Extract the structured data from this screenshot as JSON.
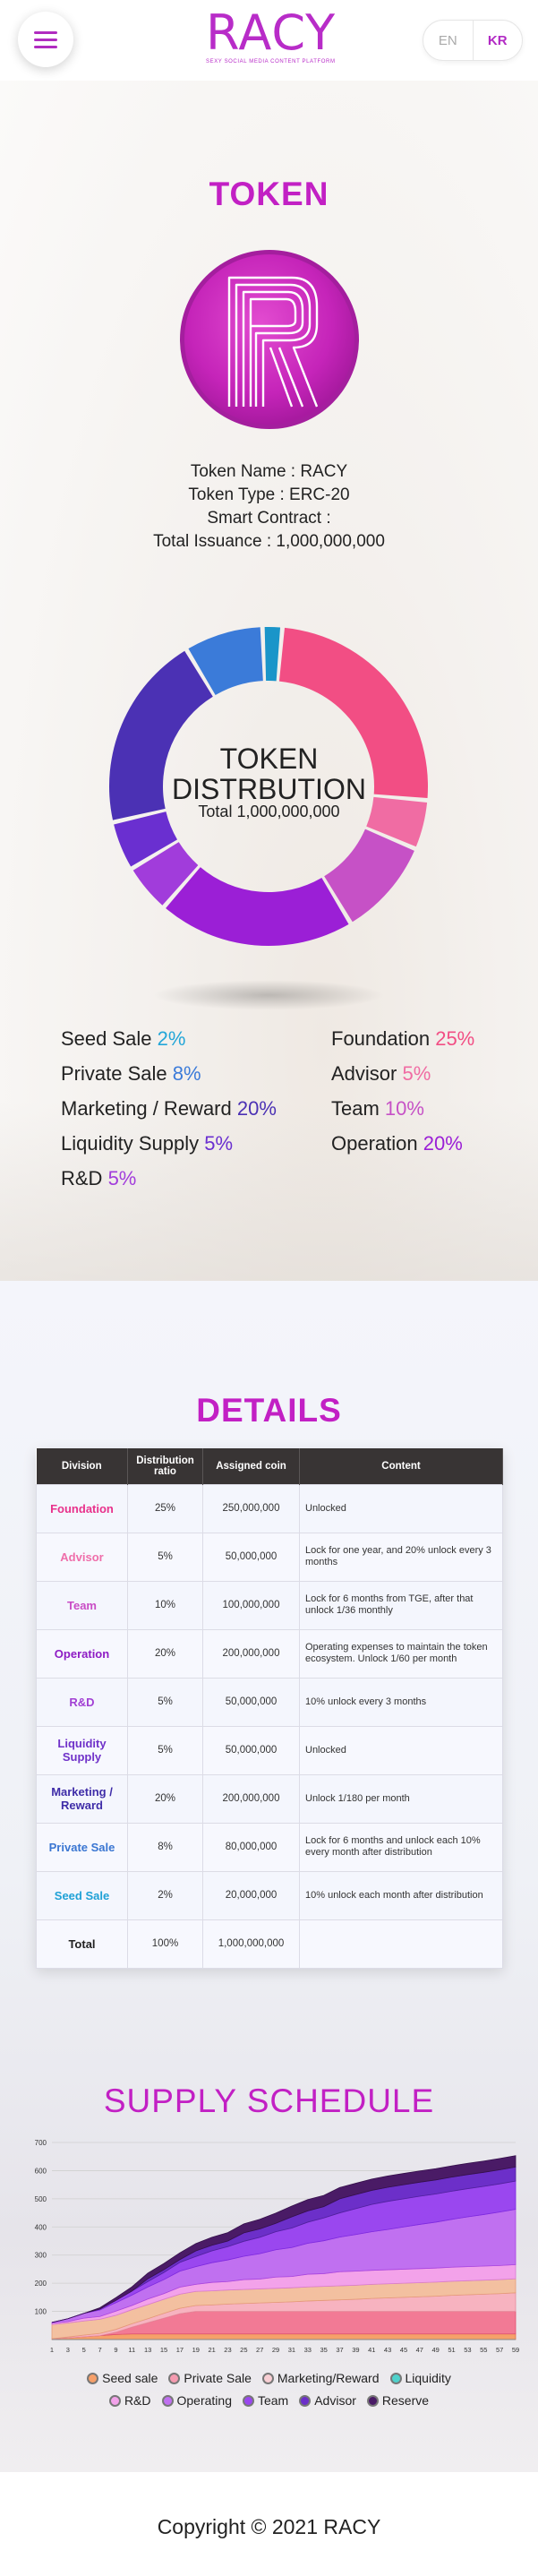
{
  "header": {
    "logo_text": "RACY",
    "logo_tagline": "SEXY SOCIAL MEDIA CONTENT PLATFORM",
    "lang_en": "EN",
    "lang_kr": "KR",
    "menu_icon": "hamburger-icon"
  },
  "token": {
    "title": "TOKEN",
    "icon": "racy-r-token-icon",
    "info_lines": [
      "Token Name : RACY",
      "Token Type : ERC-20",
      "Smart Contract :",
      "Total Issuance : 1,000,000,000"
    ],
    "donut_title_1": "TOKEN",
    "donut_title_2": "DISTRBUTION",
    "donut_total": "Total 1,000,000,000",
    "distribution": [
      {
        "name": "Foundation",
        "pct": 25,
        "pct_label": "25%",
        "color": "#f24e84"
      },
      {
        "name": "Advisor",
        "pct": 5,
        "pct_label": "5%",
        "color": "#f06ca3"
      },
      {
        "name": "Team",
        "pct": 10,
        "pct_label": "10%",
        "color": "#c651c6"
      },
      {
        "name": "Operation",
        "pct": 20,
        "pct_label": "20%",
        "color": "#9b1fd6"
      },
      {
        "name": "R&D",
        "pct": 5,
        "pct_label": "5%",
        "color": "#a13cdb"
      },
      {
        "name": "Liquidity Supply",
        "pct": 5,
        "pct_label": "5%",
        "color": "#6a2fd0"
      },
      {
        "name": "Marketing / Reward",
        "pct": 20,
        "pct_label": "20%",
        "color": "#4b31b4"
      },
      {
        "name": "Private Sale",
        "pct": 8,
        "pct_label": "8%",
        "color": "#3b7bd9"
      },
      {
        "name": "Seed Sale",
        "pct": 2,
        "pct_label": "2%",
        "color": "#1a95c9"
      }
    ],
    "legend_left": [
      {
        "name": "Seed Sale",
        "pct_label": "2%",
        "color": "#23a6d8"
      },
      {
        "name": "Private Sale",
        "pct_label": "8%",
        "color": "#3b7bd9"
      },
      {
        "name": "Marketing / Reward",
        "pct_label": "20%",
        "color": "#4b31b4"
      },
      {
        "name": "Liquidity Supply",
        "pct_label": "5%",
        "color": "#6a2fd0"
      },
      {
        "name": "R&D",
        "pct_label": "5%",
        "color": "#a13cdb"
      }
    ],
    "legend_right": [
      {
        "name": "Foundation",
        "pct_label": "25%",
        "color": "#f24e84"
      },
      {
        "name": "Advisor",
        "pct_label": "5%",
        "color": "#f06ca3"
      },
      {
        "name": "Team",
        "pct_label": "10%",
        "color": "#c651c6"
      },
      {
        "name": "Operation",
        "pct_label": "20%",
        "color": "#9b1fd6"
      }
    ]
  },
  "details": {
    "title": "DETAILS",
    "headers": [
      "Division",
      "Distribution ratio",
      "Assigned coin",
      "Content"
    ],
    "rows": [
      {
        "division": "Foundation",
        "color": "#e8318b",
        "ratio": "25%",
        "coin": "250,000,000",
        "content": "Unlocked"
      },
      {
        "division": "Advisor",
        "color": "#ef6eaa",
        "ratio": "5%",
        "coin": "50,000,000",
        "content": "Lock for one year, and 20% unlock every 3 months"
      },
      {
        "division": "Team",
        "color": "#c94dc5",
        "ratio": "10%",
        "coin": "100,000,000",
        "content": "Lock for 6 months from TGE, after that unlock 1/36 monthly"
      },
      {
        "division": "Operation",
        "color": "#8e1cc4",
        "ratio": "20%",
        "coin": "200,000,000",
        "content": "Operating expenses to maintain the token ecosystem. Unlock 1/60 per month"
      },
      {
        "division": "R&D",
        "color": "#a241d4",
        "ratio": "5%",
        "coin": "50,000,000",
        "content": "10% unlock every 3 months"
      },
      {
        "division": "Liquidity Supply",
        "color": "#7032c9",
        "ratio": "5%",
        "coin": "50,000,000",
        "content": "Unlocked"
      },
      {
        "division": "Marketing / Reward",
        "color": "#3f2da8",
        "ratio": "20%",
        "coin": "200,000,000",
        "content": "Unlock 1/180 per month"
      },
      {
        "division": "Private Sale",
        "color": "#3a76d2",
        "ratio": "8%",
        "coin": "80,000,000",
        "content": "Lock for 6 months and unlock each 10% every month after distribution"
      },
      {
        "division": "Seed Sale",
        "color": "#1fa1d6",
        "ratio": "2%",
        "coin": "20,000,000",
        "content": "10% unlock each month after distribution"
      },
      {
        "division": "Total",
        "color": "#222222",
        "ratio": "100%",
        "coin": "1,000,000,000",
        "content": ""
      }
    ]
  },
  "supply": {
    "title": "SUPPLY SCHEDULE",
    "legend_row1": [
      {
        "name": "Seed sale",
        "color": "#f6a06a"
      },
      {
        "name": "Private Sale",
        "color": "#f59bb0"
      },
      {
        "name": "Marketing/Reward",
        "color": "#f9cfd4"
      },
      {
        "name": "Liquidity",
        "color": "#4fd2cc"
      }
    ],
    "legend_row2": [
      {
        "name": "R&D",
        "color": "#f3a2ea"
      },
      {
        "name": "Operating",
        "color": "#c070f0"
      },
      {
        "name": "Team",
        "color": "#9a47ef"
      },
      {
        "name": "Advisor",
        "color": "#6c2fc9"
      },
      {
        "name": "Reserve",
        "color": "#4a1b66"
      }
    ]
  },
  "chart_data": {
    "type": "area",
    "title": "SUPPLY SCHEDULE",
    "xlabel": "",
    "ylabel": "",
    "ylim": [
      0,
      700
    ],
    "yticks": [
      100,
      200,
      300,
      400,
      500,
      600,
      700
    ],
    "xticks": [
      1,
      3,
      5,
      7,
      9,
      11,
      13,
      15,
      17,
      19,
      21,
      23,
      25,
      27,
      29,
      31,
      33,
      35,
      37,
      39,
      41,
      43,
      45,
      47,
      49,
      51,
      53,
      55,
      57,
      59
    ],
    "x": [
      1,
      3,
      5,
      7,
      9,
      11,
      13,
      15,
      17,
      19,
      21,
      23,
      25,
      27,
      29,
      31,
      33,
      35,
      37,
      39,
      41,
      43,
      45,
      47,
      49,
      51,
      53,
      55,
      57,
      59
    ],
    "stacked": true,
    "series": [
      {
        "name": "Seed sale",
        "values": [
          2,
          6,
          10,
          14,
          18,
          20,
          20,
          20,
          20,
          20,
          20,
          20,
          20,
          20,
          20,
          20,
          20,
          20,
          20,
          20,
          20,
          20,
          20,
          20,
          20,
          20,
          20,
          20,
          20,
          20
        ]
      },
      {
        "name": "Private Sale",
        "values": [
          0,
          0,
          0,
          0,
          8,
          24,
          40,
          56,
          72,
          80,
          80,
          80,
          80,
          80,
          80,
          80,
          80,
          80,
          80,
          80,
          80,
          80,
          80,
          80,
          80,
          80,
          80,
          80,
          80,
          80
        ]
      },
      {
        "name": "Marketing/Reward",
        "values": [
          1,
          3,
          6,
          8,
          10,
          12,
          14,
          17,
          19,
          21,
          23,
          26,
          28,
          30,
          32,
          34,
          37,
          39,
          41,
          43,
          46,
          48,
          50,
          52,
          54,
          57,
          59,
          61,
          63,
          66
        ]
      },
      {
        "name": "Liquidity",
        "values": [
          50,
          50,
          50,
          50,
          50,
          50,
          50,
          50,
          50,
          50,
          50,
          50,
          50,
          50,
          50,
          50,
          50,
          50,
          50,
          50,
          50,
          50,
          50,
          50,
          50,
          50,
          50,
          50,
          50,
          50
        ]
      },
      {
        "name": "R&D",
        "values": [
          5,
          5,
          10,
          10,
          15,
          15,
          20,
          20,
          25,
          25,
          30,
          30,
          35,
          35,
          40,
          40,
          45,
          45,
          50,
          50,
          50,
          50,
          50,
          50,
          50,
          50,
          50,
          50,
          50,
          50
        ]
      },
      {
        "name": "Operating",
        "values": [
          3,
          10,
          17,
          23,
          30,
          37,
          43,
          50,
          57,
          63,
          70,
          77,
          83,
          90,
          97,
          103,
          110,
          117,
          123,
          130,
          137,
          143,
          150,
          157,
          163,
          170,
          177,
          183,
          190,
          197
        ]
      },
      {
        "name": "Team",
        "values": [
          0,
          0,
          0,
          3,
          8,
          14,
          19,
          25,
          31,
          36,
          42,
          47,
          53,
          58,
          64,
          69,
          75,
          81,
          86,
          92,
          97,
          100,
          100,
          100,
          100,
          100,
          100,
          100,
          100,
          100
        ]
      },
      {
        "name": "Advisor",
        "values": [
          0,
          0,
          0,
          0,
          0,
          0,
          10,
          10,
          10,
          20,
          20,
          20,
          30,
          30,
          30,
          40,
          40,
          40,
          50,
          50,
          50,
          50,
          50,
          50,
          50,
          50,
          50,
          50,
          50,
          50
        ]
      },
      {
        "name": "Reserve",
        "values": [
          0,
          0,
          0,
          5,
          10,
          15,
          20,
          22,
          24,
          26,
          28,
          30,
          32,
          34,
          36,
          38,
          40,
          40,
          40,
          40,
          40,
          40,
          40,
          40,
          40,
          40,
          40,
          40,
          40,
          40
        ]
      }
    ]
  },
  "footer": {
    "copyright": "Copyright © 2021 RACY"
  }
}
